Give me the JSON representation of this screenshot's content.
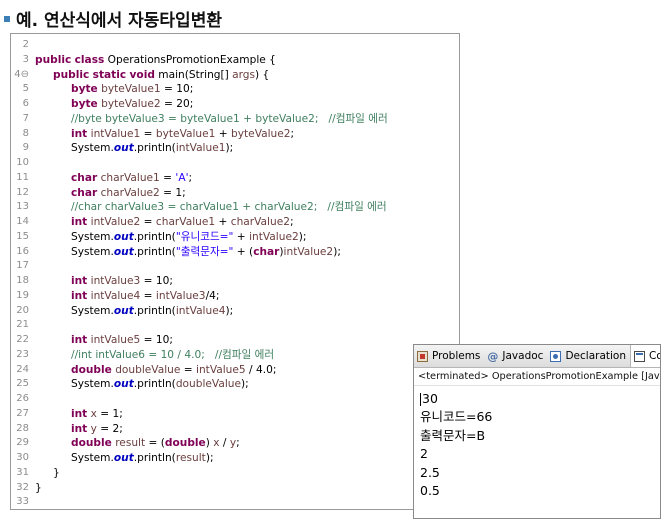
{
  "title": "예. 연산식에서 자동타입변환",
  "editor": {
    "lines": [
      {
        "n": "2",
        "indent": 0,
        "tokens": []
      },
      {
        "n": "3",
        "indent": 0,
        "tokens": [
          [
            "kw",
            "public"
          ],
          [
            "t",
            " "
          ],
          [
            "kw",
            "class"
          ],
          [
            "t",
            " OperationsPromotionExample {"
          ]
        ]
      },
      {
        "n": "4⊖",
        "indent": 1,
        "tokens": [
          [
            "kw",
            "public"
          ],
          [
            "t",
            " "
          ],
          [
            "kw",
            "static"
          ],
          [
            "t",
            " "
          ],
          [
            "kw",
            "void"
          ],
          [
            "t",
            " main(String[] "
          ],
          [
            "var",
            "args"
          ],
          [
            "t",
            ") {"
          ]
        ]
      },
      {
        "n": "5",
        "indent": 2,
        "tokens": [
          [
            "kw",
            "byte"
          ],
          [
            "t",
            " "
          ],
          [
            "var",
            "byteValue1"
          ],
          [
            "t",
            " = 10;"
          ]
        ]
      },
      {
        "n": "6",
        "indent": 2,
        "tokens": [
          [
            "kw",
            "byte"
          ],
          [
            "t",
            " "
          ],
          [
            "var",
            "byteValue2"
          ],
          [
            "t",
            " = 20;"
          ]
        ]
      },
      {
        "n": "7",
        "indent": 2,
        "tokens": [
          [
            "cm",
            "//byte byteValue3 = byteValue1 + byteValue2;   //컴파일 에러"
          ]
        ]
      },
      {
        "n": "8",
        "indent": 2,
        "tokens": [
          [
            "kw",
            "int"
          ],
          [
            "t",
            " "
          ],
          [
            "var",
            "intValue1"
          ],
          [
            "t",
            " = "
          ],
          [
            "var",
            "byteValue1"
          ],
          [
            "t",
            " + "
          ],
          [
            "var",
            "byteValue2"
          ],
          [
            "t",
            ";"
          ]
        ]
      },
      {
        "n": "9",
        "indent": 2,
        "tokens": [
          [
            "t",
            "System."
          ],
          [
            "fld",
            "out"
          ],
          [
            "t",
            ".println("
          ],
          [
            "var",
            "intValue1"
          ],
          [
            "t",
            ");"
          ]
        ]
      },
      {
        "n": "10",
        "indent": 0,
        "tokens": []
      },
      {
        "n": "11",
        "indent": 2,
        "tokens": [
          [
            "kw",
            "char"
          ],
          [
            "t",
            " "
          ],
          [
            "var",
            "charValue1"
          ],
          [
            "t",
            " = "
          ],
          [
            "str",
            "'A'"
          ],
          [
            "t",
            ";"
          ]
        ]
      },
      {
        "n": "12",
        "indent": 2,
        "tokens": [
          [
            "kw",
            "char"
          ],
          [
            "t",
            " "
          ],
          [
            "var",
            "charValue2"
          ],
          [
            "t",
            " = 1;"
          ]
        ]
      },
      {
        "n": "13",
        "indent": 2,
        "tokens": [
          [
            "cm",
            "//char charValue3 = charValue1 + charValue2;   //컴파일 에러"
          ]
        ]
      },
      {
        "n": "14",
        "indent": 2,
        "tokens": [
          [
            "kw",
            "int"
          ],
          [
            "t",
            " "
          ],
          [
            "var",
            "intValue2"
          ],
          [
            "t",
            " = "
          ],
          [
            "var",
            "charValue1"
          ],
          [
            "t",
            " + "
          ],
          [
            "var",
            "charValue2"
          ],
          [
            "t",
            ";"
          ]
        ]
      },
      {
        "n": "15",
        "indent": 2,
        "tokens": [
          [
            "t",
            "System."
          ],
          [
            "fld",
            "out"
          ],
          [
            "t",
            ".println("
          ],
          [
            "str",
            "\"유니코드=\""
          ],
          [
            "t",
            " + "
          ],
          [
            "var",
            "intValue2"
          ],
          [
            "t",
            ");"
          ]
        ]
      },
      {
        "n": "16",
        "indent": 2,
        "tokens": [
          [
            "t",
            "System."
          ],
          [
            "fld",
            "out"
          ],
          [
            "t",
            ".println("
          ],
          [
            "str",
            "\"출력문자=\""
          ],
          [
            "t",
            " + ("
          ],
          [
            "kw",
            "char"
          ],
          [
            "t",
            ")"
          ],
          [
            "var",
            "intValue2"
          ],
          [
            "t",
            ");"
          ]
        ]
      },
      {
        "n": "17",
        "indent": 0,
        "tokens": []
      },
      {
        "n": "18",
        "indent": 2,
        "tokens": [
          [
            "kw",
            "int"
          ],
          [
            "t",
            " "
          ],
          [
            "var",
            "intValue3"
          ],
          [
            "t",
            " = 10;"
          ]
        ]
      },
      {
        "n": "19",
        "indent": 2,
        "tokens": [
          [
            "kw",
            "int"
          ],
          [
            "t",
            " "
          ],
          [
            "var",
            "intValue4"
          ],
          [
            "t",
            " = "
          ],
          [
            "var",
            "intValue3"
          ],
          [
            "t",
            "/4;"
          ]
        ]
      },
      {
        "n": "20",
        "indent": 2,
        "tokens": [
          [
            "t",
            "System."
          ],
          [
            "fld",
            "out"
          ],
          [
            "t",
            ".println("
          ],
          [
            "var",
            "intValue4"
          ],
          [
            "t",
            ");"
          ]
        ]
      },
      {
        "n": "21",
        "indent": 0,
        "tokens": []
      },
      {
        "n": "22",
        "indent": 2,
        "tokens": [
          [
            "kw",
            "int"
          ],
          [
            "t",
            " "
          ],
          [
            "var",
            "intValue5"
          ],
          [
            "t",
            " = 10;"
          ]
        ]
      },
      {
        "n": "23",
        "indent": 2,
        "tokens": [
          [
            "cm",
            "//int intValue6 = 10 / 4.0;   //컴파일 에러"
          ]
        ]
      },
      {
        "n": "24",
        "indent": 2,
        "tokens": [
          [
            "kw",
            "double"
          ],
          [
            "t",
            " "
          ],
          [
            "var",
            "doubleValue"
          ],
          [
            "t",
            " = "
          ],
          [
            "var",
            "intValue5"
          ],
          [
            "t",
            " / 4.0;"
          ]
        ]
      },
      {
        "n": "25",
        "indent": 2,
        "tokens": [
          [
            "t",
            "System."
          ],
          [
            "fld",
            "out"
          ],
          [
            "t",
            ".println("
          ],
          [
            "var",
            "doubleValue"
          ],
          [
            "t",
            ");"
          ]
        ]
      },
      {
        "n": "26",
        "indent": 0,
        "tokens": []
      },
      {
        "n": "27",
        "indent": 2,
        "tokens": [
          [
            "kw",
            "int"
          ],
          [
            "t",
            " "
          ],
          [
            "var",
            "x"
          ],
          [
            "t",
            " = 1;"
          ]
        ]
      },
      {
        "n": "28",
        "indent": 2,
        "tokens": [
          [
            "kw",
            "int"
          ],
          [
            "t",
            " "
          ],
          [
            "var",
            "y"
          ],
          [
            "t",
            " = 2;"
          ]
        ]
      },
      {
        "n": "29",
        "indent": 2,
        "tokens": [
          [
            "kw",
            "double"
          ],
          [
            "t",
            " "
          ],
          [
            "var",
            "result"
          ],
          [
            "t",
            " = ("
          ],
          [
            "kw",
            "double"
          ],
          [
            "t",
            ") "
          ],
          [
            "var",
            "x"
          ],
          [
            "t",
            " / "
          ],
          [
            "var",
            "y"
          ],
          [
            "t",
            ";"
          ]
        ]
      },
      {
        "n": "30",
        "indent": 2,
        "tokens": [
          [
            "t",
            "System."
          ],
          [
            "fld",
            "out"
          ],
          [
            "t",
            ".println("
          ],
          [
            "var",
            "result"
          ],
          [
            "t",
            ");"
          ]
        ]
      },
      {
        "n": "31",
        "indent": 1,
        "tokens": [
          [
            "t",
            "}"
          ]
        ]
      },
      {
        "n": "32",
        "indent": 0,
        "tokens": [
          [
            "t",
            "}"
          ]
        ]
      },
      {
        "n": "33",
        "indent": 0,
        "tokens": []
      }
    ]
  },
  "console": {
    "tabs": [
      {
        "label": "Problems",
        "icon": "problems-icon"
      },
      {
        "label": "Javadoc",
        "icon": "javadoc-icon"
      },
      {
        "label": "Declaration",
        "icon": "declaration-icon"
      },
      {
        "label": "Console",
        "icon": "console-icon"
      }
    ],
    "terminated": "<terminated> OperationsPromotionExample [Java Application]",
    "output": [
      "30",
      "유니코드=66",
      "출력문자=B",
      "2",
      "2.5",
      "0.5"
    ]
  }
}
